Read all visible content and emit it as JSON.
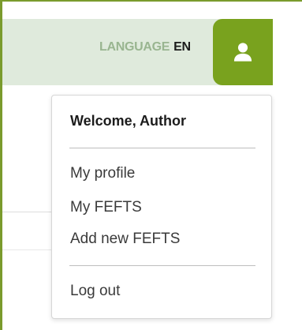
{
  "header": {
    "language_label": "LANGUAGE",
    "language_code": "EN",
    "user_button_icon": "user-icon"
  },
  "user_menu": {
    "welcome": "Welcome, Author",
    "items": [
      {
        "label": "My profile"
      },
      {
        "label": "My FEFTS"
      },
      {
        "label": "Add new FEFTS"
      }
    ],
    "logout": "Log out"
  },
  "colors": {
    "accent_green": "#79a21e",
    "header_bg": "#dfeadc",
    "language_label": "#99b590",
    "frame_border": "#7a9b2d"
  }
}
